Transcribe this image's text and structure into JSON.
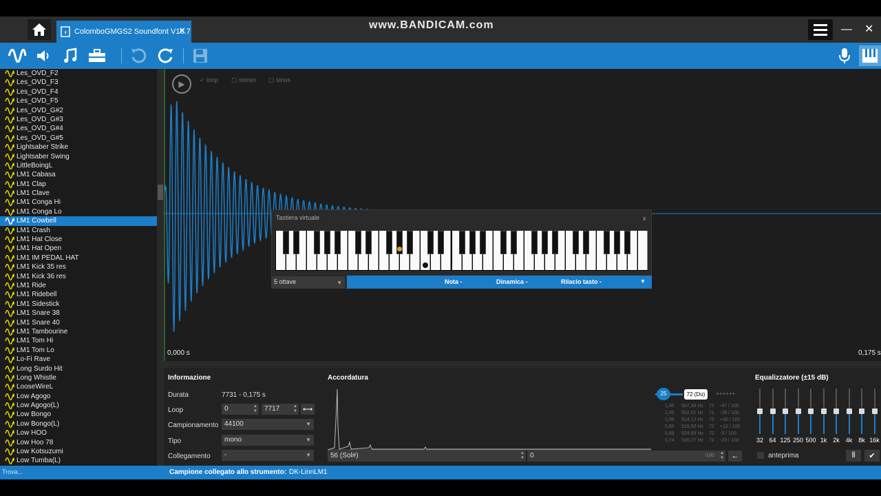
{
  "window": {
    "tab_title": "ColomboGMGS2 Soundfont V16.7",
    "watermark": "www.BANDICAM.com"
  },
  "toolbar": {
    "icons": [
      "wave-icon",
      "speaker-icon",
      "music-note-icon",
      "toolbox-icon",
      "undo-icon",
      "redo-icon",
      "save-icon",
      "microphone-icon",
      "piano-icon"
    ]
  },
  "sidebar": {
    "selected": "LM1 Cowbell",
    "items": [
      "Les_OVD_F2",
      "Les_OVD_F3",
      "Les_OVD_F4",
      "Les_OVD_F5",
      "Les_OVD_G#2",
      "Les_OVD_G#3",
      "Les_OVD_G#4",
      "Les_OVD_G#5",
      "Lightsaber Strike",
      "Lightsaber Swing",
      "LittleBoingL",
      "LM1 Cabasa",
      "LM1 Clap",
      "LM1 Clave",
      "LM1 Conga Hi",
      "LM1 Conga Lo",
      "LM1 Cowbell",
      "LM1 Crash",
      "LM1 Hat Close",
      "LM1 Hat Open",
      "LM1 IM PEDAL HAT",
      "LM1 Kick 35 res",
      "LM1 Kick 36 res",
      "LM1 Ride",
      "LM1 Ridebell",
      "LM1 Sidestick",
      "LM1 Snare 38",
      "LM1 Snare 40",
      "LM1 Tambourine",
      "LM1 Tom Hi",
      "LM1 Tom Lo",
      "Lo-Fi Rave",
      "Long Surdo Hit",
      "Long Whistle",
      "LooseWireL",
      "Low Agogo",
      "Low Agogo(L)",
      "Low Bongo",
      "Low Bongo(L)",
      "Low HOO",
      "Low Hoo 78",
      "Low Kotsuzumi",
      "Low Tumba(L)"
    ]
  },
  "waveform": {
    "options": {
      "loop": "loop",
      "stereo": "stereo",
      "sinus": "sinus"
    },
    "time_start": "0,000 s",
    "time_end": "0,175 s",
    "color": "#1c7ec8"
  },
  "keyboard": {
    "title": "Tastiera virtuale",
    "close": "x",
    "octaves": "5 ottave",
    "nota_label": "Nota",
    "nota_value": "-",
    "dinamica_label": "Dinamica",
    "dinamica_value": "-",
    "rilascio_label": "Rilacio tasto",
    "rilascio_value": "-"
  },
  "info": {
    "title": "Informazione",
    "durata_label": "Durata",
    "durata_value": "7731 - 0,175 s",
    "loop_label": "Loop",
    "loop_start": "0",
    "loop_end": "7717",
    "campionamento_label": "Campionamento",
    "campionamento_value": "44100",
    "tipo_label": "Tipo",
    "tipo_value": "mono",
    "collegamento_label": "Collegamento",
    "collegamento_value": "-"
  },
  "tuning": {
    "title": "Accordatura",
    "slider_value": "25",
    "note_badge": "72 (Do)",
    "root_value": "56 (Sol#)",
    "fine_value": "0",
    "fine_unit": "/100",
    "rows": [
      [
        "1,00",
        "507,39 Hz",
        "71",
        "-47 / 100"
      ],
      [
        "1,00",
        "502,01 Hz",
        "71",
        "-28 / 100"
      ],
      [
        "0,95",
        "514,12 Hz",
        "72",
        "+30 / 100"
      ],
      [
        "0,95",
        "519,50 Hz",
        "72",
        "+12 / 100"
      ],
      [
        "0,89",
        "524,89 Hz",
        "72",
        "-5 / 100"
      ],
      [
        "0,74",
        "530,27 Hz",
        "72",
        "-23 / 100"
      ]
    ]
  },
  "equalizer": {
    "title": "Equalizzatore (±15 dB)",
    "bands": [
      "32",
      "64",
      "125",
      "250",
      "500",
      "1k",
      "2k",
      "4k",
      "8k",
      "16k"
    ],
    "preview_label": "anteprima"
  },
  "status": {
    "find_placeholder": "Trova...",
    "label": "Campione collegato allo strumento:",
    "value": "DK-LinnLM1"
  }
}
